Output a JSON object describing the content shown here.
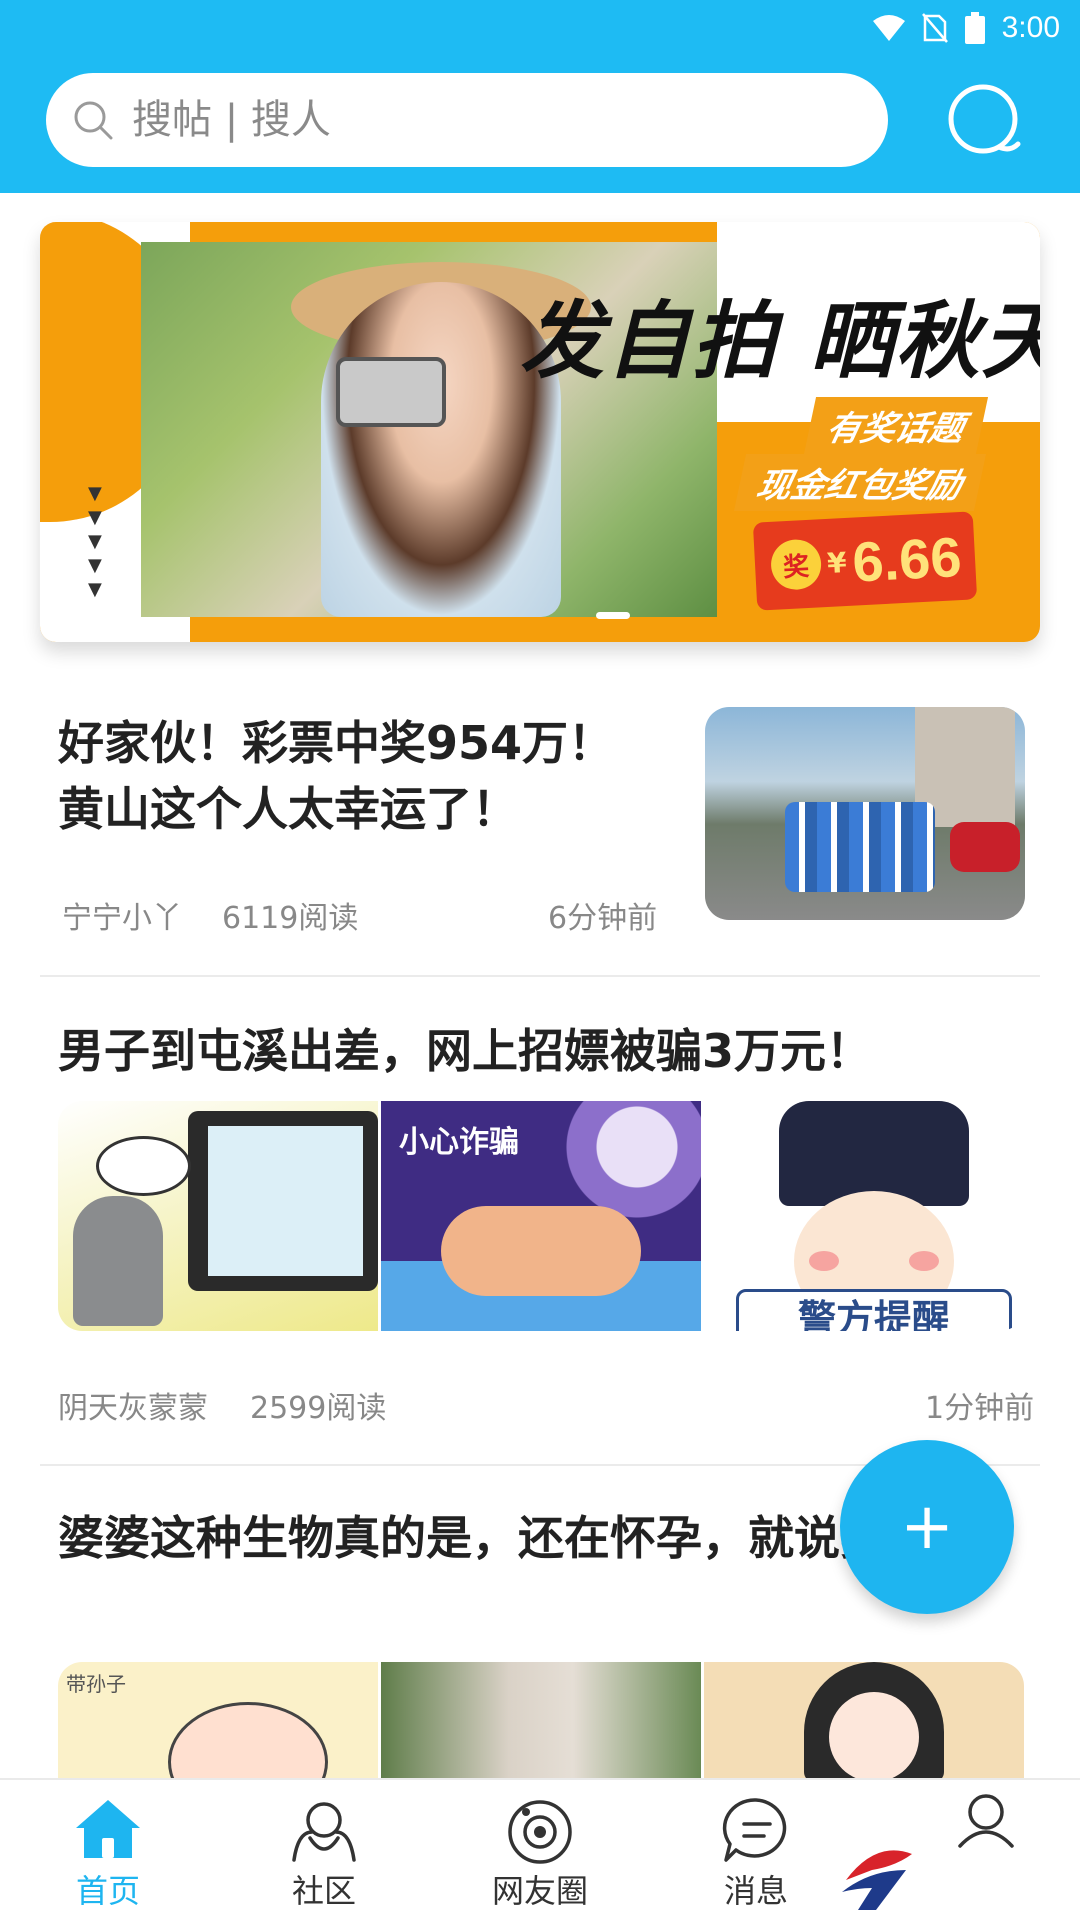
{
  "status_bar": {
    "time": "3:00",
    "icons": [
      "wifi-icon",
      "no-sim-icon",
      "battery-icon"
    ]
  },
  "search": {
    "placeholder": "搜帖 | 搜人"
  },
  "banner": {
    "title": "发自拍 晒秋天",
    "subtitle_1": "有奖话题",
    "subtitle_2": "现金红包奖励",
    "prize_badge": "奖",
    "currency": "¥",
    "amount": "6.66",
    "arrows": "▼\n▼\n▼\n▼\n▼",
    "accent_color": "#F59E0B"
  },
  "articles": [
    {
      "title": "好家伙！彩票中奖954万！黄山这个人太幸运了！",
      "author": "宁宁小丫",
      "reads": "6119阅读",
      "time": "6分钟前"
    },
    {
      "title": "男子到屯溪出差，网上招嫖被骗3万元！",
      "image_caption": "小心诈骗",
      "image_sign": "警方提醒",
      "author": "阴天灰蒙蒙",
      "reads": "2599阅读",
      "time": "1分钟前"
    },
    {
      "title": "婆婆这种生物真的是，还在怀孕，就说要二胎?",
      "image_label": "带孙子"
    }
  ],
  "fab": {
    "label": "+"
  },
  "bottom_nav": [
    {
      "label": "首页",
      "icon": "home-icon",
      "active": true
    },
    {
      "label": "社区",
      "icon": "community-icon",
      "active": false
    },
    {
      "label": "网友圈",
      "icon": "friends-circle-icon",
      "active": false
    },
    {
      "label": "消息",
      "icon": "message-icon",
      "active": false
    },
    {
      "label": "",
      "icon": "profile-icon",
      "active": false
    }
  ],
  "colors": {
    "primary": "#1EBBF3",
    "active_nav": "#1EB5F0",
    "meta_text": "#888888"
  }
}
